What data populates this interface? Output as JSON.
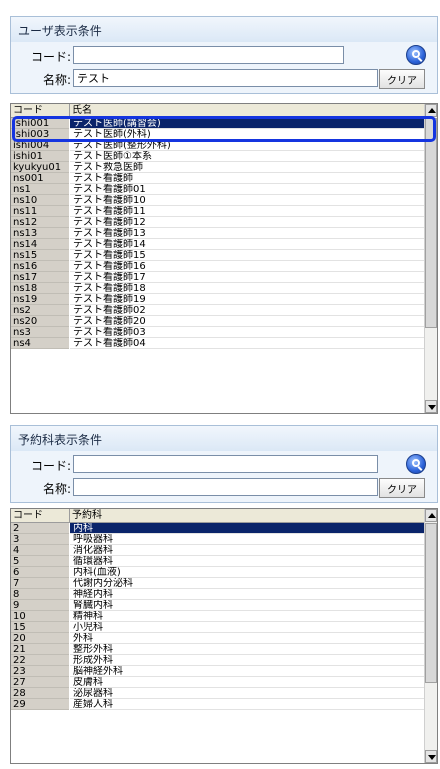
{
  "user_filter": {
    "title": "ユーザ表示条件",
    "code_label": "コード:",
    "code_value": "",
    "name_label": "名称:",
    "name_value": "テスト",
    "clear_label": "クリア"
  },
  "user_list": {
    "columns": [
      "コード",
      "氏名"
    ],
    "selected_index": 0,
    "rows": [
      {
        "code": "ishi001",
        "name": "テスト医師(講習会)"
      },
      {
        "code": "ishi003",
        "name": "テスト医師(外科)"
      },
      {
        "code": "ishi004",
        "name": "テスト医師(整形外科)"
      },
      {
        "code": "ishi01",
        "name": "テスト医師①本系"
      },
      {
        "code": "kyukyu01",
        "name": "テスト救急医師"
      },
      {
        "code": "ns001",
        "name": "テスト看護師"
      },
      {
        "code": "ns1",
        "name": "テスト看護師01"
      },
      {
        "code": "ns10",
        "name": "テスト看護師10"
      },
      {
        "code": "ns11",
        "name": "テスト看護師11"
      },
      {
        "code": "ns12",
        "name": "テスト看護師12"
      },
      {
        "code": "ns13",
        "name": "テスト看護師13"
      },
      {
        "code": "ns14",
        "name": "テスト看護師14"
      },
      {
        "code": "ns15",
        "name": "テスト看護師15"
      },
      {
        "code": "ns16",
        "name": "テスト看護師16"
      },
      {
        "code": "ns17",
        "name": "テスト看護師17"
      },
      {
        "code": "ns18",
        "name": "テスト看護師18"
      },
      {
        "code": "ns19",
        "name": "テスト看護師19"
      },
      {
        "code": "ns2",
        "name": "テスト看護師02"
      },
      {
        "code": "ns20",
        "name": "テスト看護師20"
      },
      {
        "code": "ns3",
        "name": "テスト看護師03"
      },
      {
        "code": "ns4",
        "name": "テスト看護師04"
      }
    ]
  },
  "dept_filter": {
    "title": "予約科表示条件",
    "code_label": "コード:",
    "code_value": "",
    "name_label": "名称:",
    "name_value": "",
    "clear_label": "クリア"
  },
  "dept_list": {
    "columns": [
      "コード",
      "予約科"
    ],
    "selected_index": 0,
    "rows": [
      {
        "code": "2",
        "name": "内科"
      },
      {
        "code": "3",
        "name": "呼吸器科"
      },
      {
        "code": "4",
        "name": "消化器科"
      },
      {
        "code": "5",
        "name": "循環器科"
      },
      {
        "code": "6",
        "name": "内科(血液)"
      },
      {
        "code": "7",
        "name": "代謝内分泌科"
      },
      {
        "code": "8",
        "name": "神経内科"
      },
      {
        "code": "9",
        "name": "腎臓内科"
      },
      {
        "code": "10",
        "name": "精神科"
      },
      {
        "code": "15",
        "name": "小児科"
      },
      {
        "code": "20",
        "name": "外科"
      },
      {
        "code": "21",
        "name": "整形外科"
      },
      {
        "code": "22",
        "name": "形成外科"
      },
      {
        "code": "23",
        "name": "脳神経外科"
      },
      {
        "code": "27",
        "name": "皮膚科"
      },
      {
        "code": "28",
        "name": "泌尿器科"
      },
      {
        "code": "29",
        "name": "産婦人科"
      }
    ]
  },
  "colors": {
    "selection": "#0a246a",
    "highlight": "#1535e0"
  }
}
